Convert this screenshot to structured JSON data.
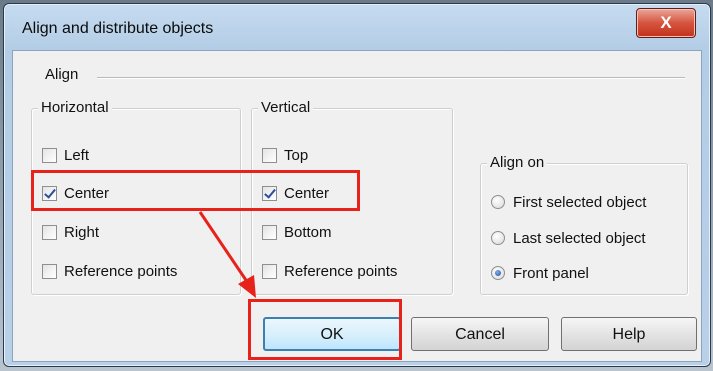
{
  "window": {
    "title": "Align and distribute objects",
    "close_glyph": "X"
  },
  "align_group": {
    "label": "Align"
  },
  "horizontal": {
    "label": "Horizontal",
    "items": [
      {
        "label": "Left",
        "checked": false
      },
      {
        "label": "Center",
        "checked": true
      },
      {
        "label": "Right",
        "checked": false
      },
      {
        "label": "Reference points",
        "checked": false
      }
    ]
  },
  "vertical": {
    "label": "Vertical",
    "items": [
      {
        "label": "Top",
        "checked": false
      },
      {
        "label": "Center",
        "checked": true
      },
      {
        "label": "Bottom",
        "checked": false
      },
      {
        "label": "Reference points",
        "checked": false
      }
    ]
  },
  "align_on": {
    "label": "Align on",
    "options": [
      {
        "label": "First selected object",
        "selected": false
      },
      {
        "label": "Last selected object",
        "selected": false
      },
      {
        "label": "Front panel",
        "selected": true
      }
    ]
  },
  "buttons": {
    "ok": "OK",
    "cancel": "Cancel",
    "help": "Help"
  },
  "annotation": {
    "color": "#e6221b"
  }
}
